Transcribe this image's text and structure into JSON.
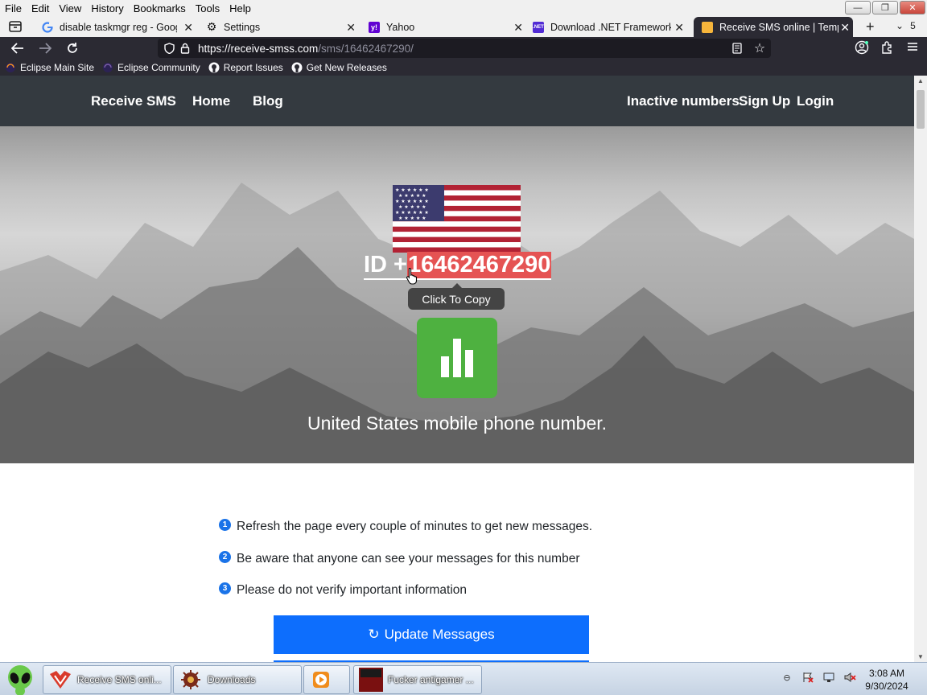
{
  "menubar": {
    "items": [
      {
        "label": "File"
      },
      {
        "label": "Edit"
      },
      {
        "label": "View"
      },
      {
        "label": "History"
      },
      {
        "label": "Bookmarks"
      },
      {
        "label": "Tools"
      },
      {
        "label": "Help"
      }
    ]
  },
  "tabs": [
    {
      "label": "disable taskmgr reg - Googl",
      "icon": "google-icon"
    },
    {
      "label": "Settings",
      "icon": "gear-icon"
    },
    {
      "label": "Yahoo",
      "icon": "yahoo-icon"
    },
    {
      "label": "Download .NET Framework",
      "icon": "dotnet-icon"
    },
    {
      "label": "Receive SMS online | Tempc",
      "icon": "site-icon",
      "active": true
    }
  ],
  "tab_count": "5",
  "address": {
    "host": "https://receive-smss.com",
    "path": "/sms/16462467290/"
  },
  "bookmarks": [
    {
      "label": "Eclipse Main Site",
      "icon": "eclipse-icon"
    },
    {
      "label": "Eclipse Community",
      "icon": "eclipse-icon"
    },
    {
      "label": "Report Issues",
      "icon": "github-icon"
    },
    {
      "label": "Get New Releases",
      "icon": "github-icon"
    }
  ],
  "site": {
    "brand": "Receive SMS",
    "nav_left": [
      "Home",
      "Blog"
    ],
    "nav_right": [
      "Inactive numbers",
      "Sign Up",
      "Login"
    ],
    "id_prefix": "ID +",
    "phone_number": "16462467290",
    "tooltip": "Click To Copy",
    "subtitle": "United States mobile phone number.",
    "info": [
      {
        "num": "1",
        "text": "Refresh the page every couple of minutes to get new messages."
      },
      {
        "num": "2",
        "text": "Be aware that anyone can see your messages for this number"
      },
      {
        "num": "3",
        "text": "Please do not verify important information"
      }
    ],
    "update_button": "Update Messages",
    "update_icon": "↻"
  },
  "taskbar": {
    "items": [
      {
        "label": "Receive SMS onli...",
        "icon": "firefox-icon"
      },
      {
        "label": "Downloads",
        "icon": "downloads-icon"
      },
      {
        "label": "",
        "icon": "media-player-icon"
      },
      {
        "label": "Fucker antigamer ...",
        "icon": "app-icon"
      }
    ],
    "time": "3:08 AM",
    "date": "9/30/2024"
  },
  "colors": {
    "browser_chrome": "#2b2a33",
    "site_nav": "#343a40",
    "number_highlight": "#e55353",
    "stats_green": "#4eb140",
    "button_blue": "#0d6efd"
  }
}
